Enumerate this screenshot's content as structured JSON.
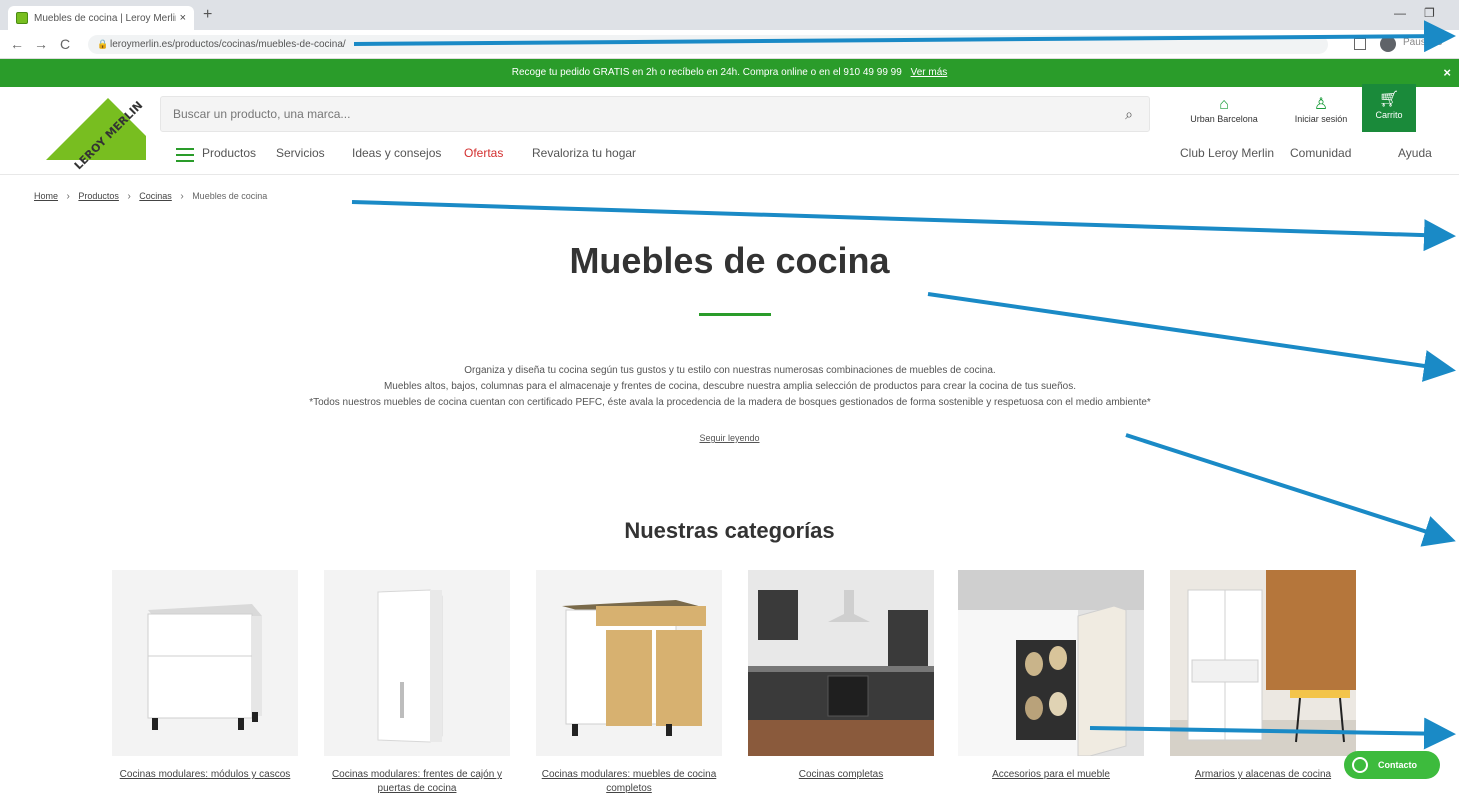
{
  "browser": {
    "tab_title": "Muebles de cocina | Leroy Merlin",
    "tab_close": "×",
    "new_tab": "+",
    "back": "←",
    "forward": "→",
    "reload": "C",
    "url": "leroymerlin.es/productos/cocinas/muebles-de-cocina/",
    "window_min": "—",
    "window_max": "❐",
    "pending_label": "Pausado"
  },
  "promo": {
    "text": "Recoge tu pedido GRATIS en 2h o recíbelo en 24h. Compra online o en el 910 49 99 99",
    "link": "Ver más",
    "close": "×"
  },
  "header": {
    "logo_text": "LEROY MERLIN",
    "search_placeholder": "Buscar un producto, una marca...",
    "store_label": "Urban Barcelona",
    "login_label": "Iniciar sesión",
    "cart_label": "Carrito"
  },
  "nav": {
    "left": [
      "Productos",
      "Servicios",
      "Ideas y consejos",
      "Ofertas",
      "Revaloriza tu hogar"
    ],
    "right": [
      "Club Leroy Merlin",
      "Comunidad",
      "Ayuda"
    ]
  },
  "breadcrumb": [
    "Home",
    "Productos",
    "Cocinas",
    "Muebles de cocina"
  ],
  "main": {
    "title": "Muebles de cocina",
    "intro": [
      "Organiza y diseña tu cocina según tus gustos y tu estilo con nuestras numerosas combinaciones de muebles de cocina.",
      "Muebles altos, bajos, columnas para el almacenaje y frentes de cocina, descubre nuestra amplia selección de productos para crear la cocina de tus sueños.",
      "*Todos nuestros muebles de cocina cuentan con certificado PEFC, éste avala la procedencia de la madera de bosques gestionados de forma sostenible y respetuosa con el medio ambiente*"
    ],
    "read_more": "Seguir leyendo",
    "categories_title": "Nuestras categorías"
  },
  "categories": [
    {
      "label": "Cocinas modulares: módulos y cascos"
    },
    {
      "label": "Cocinas modulares: frentes de cajón y puertas de cocina"
    },
    {
      "label": "Cocinas modulares: muebles de cocina completos"
    },
    {
      "label": "Cocinas completas"
    },
    {
      "label": "Accesorios para el mueble"
    },
    {
      "label": "Armarios y alacenas de cocina"
    }
  ],
  "contact_button": "Contacto",
  "colors": {
    "brand_green": "#2a9c2a",
    "annotation_blue": "#1a8ac6"
  }
}
